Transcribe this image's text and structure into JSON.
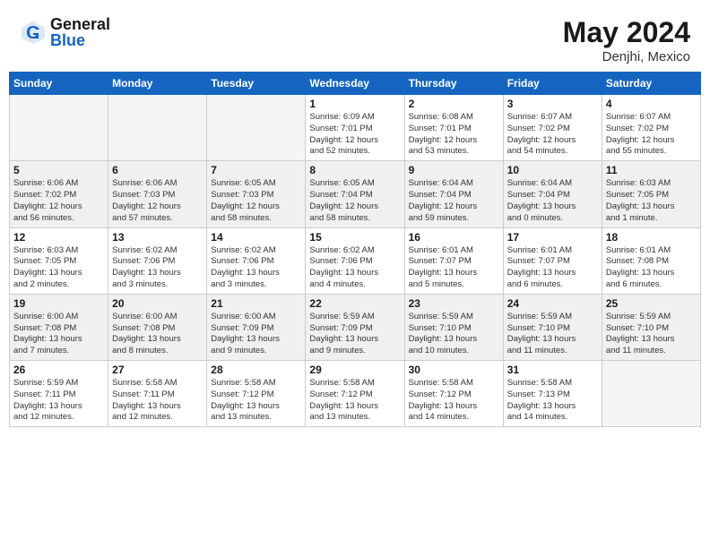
{
  "header": {
    "logo_line1": "General",
    "logo_line2": "Blue",
    "month": "May 2024",
    "location": "Denjhi, Mexico"
  },
  "weekdays": [
    "Sunday",
    "Monday",
    "Tuesday",
    "Wednesday",
    "Thursday",
    "Friday",
    "Saturday"
  ],
  "weeks": [
    [
      {
        "day": "",
        "info": ""
      },
      {
        "day": "",
        "info": ""
      },
      {
        "day": "",
        "info": ""
      },
      {
        "day": "1",
        "info": "Sunrise: 6:09 AM\nSunset: 7:01 PM\nDaylight: 12 hours\nand 52 minutes."
      },
      {
        "day": "2",
        "info": "Sunrise: 6:08 AM\nSunset: 7:01 PM\nDaylight: 12 hours\nand 53 minutes."
      },
      {
        "day": "3",
        "info": "Sunrise: 6:07 AM\nSunset: 7:02 PM\nDaylight: 12 hours\nand 54 minutes."
      },
      {
        "day": "4",
        "info": "Sunrise: 6:07 AM\nSunset: 7:02 PM\nDaylight: 12 hours\nand 55 minutes."
      }
    ],
    [
      {
        "day": "5",
        "info": "Sunrise: 6:06 AM\nSunset: 7:02 PM\nDaylight: 12 hours\nand 56 minutes."
      },
      {
        "day": "6",
        "info": "Sunrise: 6:06 AM\nSunset: 7:03 PM\nDaylight: 12 hours\nand 57 minutes."
      },
      {
        "day": "7",
        "info": "Sunrise: 6:05 AM\nSunset: 7:03 PM\nDaylight: 12 hours\nand 58 minutes."
      },
      {
        "day": "8",
        "info": "Sunrise: 6:05 AM\nSunset: 7:04 PM\nDaylight: 12 hours\nand 58 minutes."
      },
      {
        "day": "9",
        "info": "Sunrise: 6:04 AM\nSunset: 7:04 PM\nDaylight: 12 hours\nand 59 minutes."
      },
      {
        "day": "10",
        "info": "Sunrise: 6:04 AM\nSunset: 7:04 PM\nDaylight: 13 hours\nand 0 minutes."
      },
      {
        "day": "11",
        "info": "Sunrise: 6:03 AM\nSunset: 7:05 PM\nDaylight: 13 hours\nand 1 minute."
      }
    ],
    [
      {
        "day": "12",
        "info": "Sunrise: 6:03 AM\nSunset: 7:05 PM\nDaylight: 13 hours\nand 2 minutes."
      },
      {
        "day": "13",
        "info": "Sunrise: 6:02 AM\nSunset: 7:06 PM\nDaylight: 13 hours\nand 3 minutes."
      },
      {
        "day": "14",
        "info": "Sunrise: 6:02 AM\nSunset: 7:06 PM\nDaylight: 13 hours\nand 3 minutes."
      },
      {
        "day": "15",
        "info": "Sunrise: 6:02 AM\nSunset: 7:06 PM\nDaylight: 13 hours\nand 4 minutes."
      },
      {
        "day": "16",
        "info": "Sunrise: 6:01 AM\nSunset: 7:07 PM\nDaylight: 13 hours\nand 5 minutes."
      },
      {
        "day": "17",
        "info": "Sunrise: 6:01 AM\nSunset: 7:07 PM\nDaylight: 13 hours\nand 6 minutes."
      },
      {
        "day": "18",
        "info": "Sunrise: 6:01 AM\nSunset: 7:08 PM\nDaylight: 13 hours\nand 6 minutes."
      }
    ],
    [
      {
        "day": "19",
        "info": "Sunrise: 6:00 AM\nSunset: 7:08 PM\nDaylight: 13 hours\nand 7 minutes."
      },
      {
        "day": "20",
        "info": "Sunrise: 6:00 AM\nSunset: 7:08 PM\nDaylight: 13 hours\nand 8 minutes."
      },
      {
        "day": "21",
        "info": "Sunrise: 6:00 AM\nSunset: 7:09 PM\nDaylight: 13 hours\nand 9 minutes."
      },
      {
        "day": "22",
        "info": "Sunrise: 5:59 AM\nSunset: 7:09 PM\nDaylight: 13 hours\nand 9 minutes."
      },
      {
        "day": "23",
        "info": "Sunrise: 5:59 AM\nSunset: 7:10 PM\nDaylight: 13 hours\nand 10 minutes."
      },
      {
        "day": "24",
        "info": "Sunrise: 5:59 AM\nSunset: 7:10 PM\nDaylight: 13 hours\nand 11 minutes."
      },
      {
        "day": "25",
        "info": "Sunrise: 5:59 AM\nSunset: 7:10 PM\nDaylight: 13 hours\nand 11 minutes."
      }
    ],
    [
      {
        "day": "26",
        "info": "Sunrise: 5:59 AM\nSunset: 7:11 PM\nDaylight: 13 hours\nand 12 minutes."
      },
      {
        "day": "27",
        "info": "Sunrise: 5:58 AM\nSunset: 7:11 PM\nDaylight: 13 hours\nand 12 minutes."
      },
      {
        "day": "28",
        "info": "Sunrise: 5:58 AM\nSunset: 7:12 PM\nDaylight: 13 hours\nand 13 minutes."
      },
      {
        "day": "29",
        "info": "Sunrise: 5:58 AM\nSunset: 7:12 PM\nDaylight: 13 hours\nand 13 minutes."
      },
      {
        "day": "30",
        "info": "Sunrise: 5:58 AM\nSunset: 7:12 PM\nDaylight: 13 hours\nand 14 minutes."
      },
      {
        "day": "31",
        "info": "Sunrise: 5:58 AM\nSunset: 7:13 PM\nDaylight: 13 hours\nand 14 minutes."
      },
      {
        "day": "",
        "info": ""
      }
    ]
  ]
}
